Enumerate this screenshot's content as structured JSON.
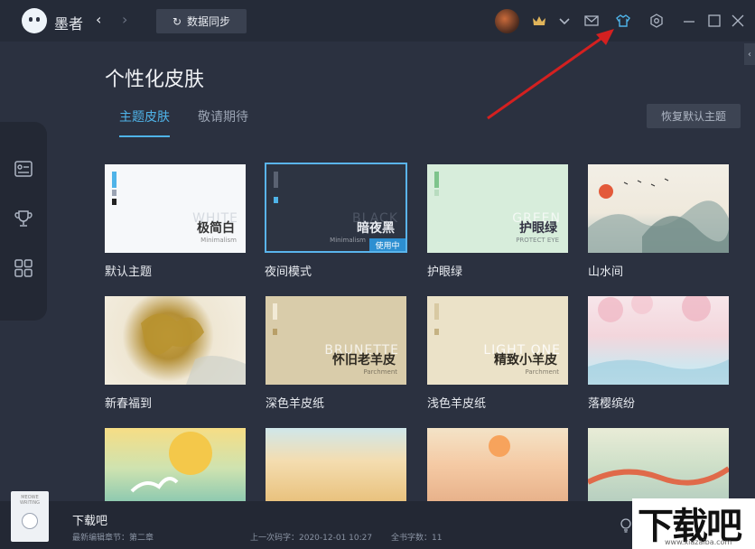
{
  "app": {
    "name": "墨者"
  },
  "titlebar": {
    "sync_label": "数据同步",
    "back_glyph": "‹",
    "forward_glyph": "›"
  },
  "page": {
    "title": "个性化皮肤",
    "tabs": [
      {
        "label": "主题皮肤",
        "active": true
      },
      {
        "label": "敬请期待",
        "active": false
      }
    ],
    "restore_label": "恢复默认主题"
  },
  "skins": [
    {
      "label": "默认主题",
      "title": "极简白",
      "en": "WHITE",
      "sub": "Minimalism"
    },
    {
      "label": "夜间模式",
      "title": "暗夜黑",
      "en": "BLACK",
      "sub": "Minimalism",
      "badge": "使用中"
    },
    {
      "label": "护眼绿",
      "title": "护眼绿",
      "en": "GREEN",
      "sub": "PROTECT EYE"
    },
    {
      "label": "山水间",
      "title": "",
      "en": "",
      "sub": ""
    },
    {
      "label": "新春福到",
      "title": "",
      "en": "",
      "sub": ""
    },
    {
      "label": "深色羊皮纸",
      "title": "怀旧老羊皮",
      "en": "BRUNETTE",
      "sub": "Parchment"
    },
    {
      "label": "浅色羊皮纸",
      "title": "精致小羊皮",
      "en": "LIGHT ONE",
      "sub": "Parchment"
    },
    {
      "label": "落樱缤纷",
      "title": "",
      "en": "",
      "sub": ""
    }
  ],
  "bottom": {
    "book_cover_text": "MEOWE WRITING",
    "book_name": "下载吧",
    "last_chapter": "最新编辑章节：第二章",
    "last_code": "上一次码字：2020-12-01 10:27",
    "total_words": "全书字数：11"
  },
  "watermark": {
    "main": "下载吧",
    "url": "www.xiazaiba.com"
  },
  "colors": {
    "accent": "#4fb3e8",
    "background": "#2b3140",
    "arrow": "#d42020"
  }
}
